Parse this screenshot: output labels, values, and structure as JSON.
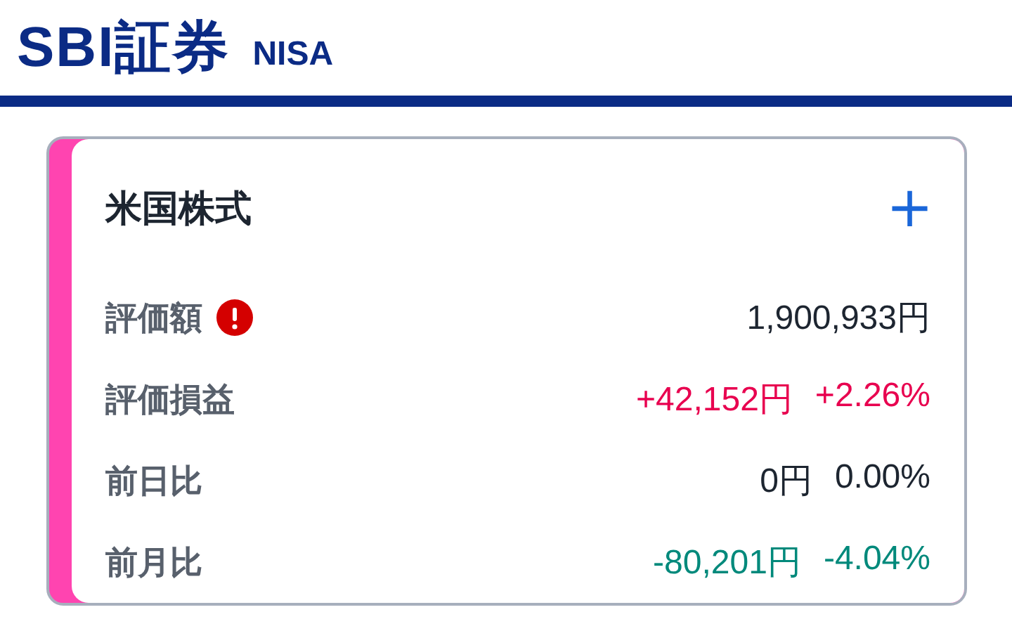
{
  "header": {
    "brand": "SBI証券",
    "tag": "NISA"
  },
  "card": {
    "title": "米国株式",
    "add_icon": "+",
    "rows": [
      {
        "label": "評価額",
        "warning": true,
        "values": [
          {
            "text": "1,900,933円",
            "color": "#1d2530"
          }
        ]
      },
      {
        "label": "評価損益",
        "warning": false,
        "values": [
          {
            "text": "+42,152円",
            "color": "#e8004f"
          },
          {
            "text": "+2.26%",
            "color": "#e8004f"
          }
        ]
      },
      {
        "label": "前日比",
        "warning": false,
        "values": [
          {
            "text": "0円",
            "color": "#1d2530"
          },
          {
            "text": "0.00%",
            "color": "#1d2530"
          }
        ]
      },
      {
        "label": "前月比",
        "warning": false,
        "values": [
          {
            "text": "-80,201円",
            "color": "#00897b"
          },
          {
            "text": "-4.04%",
            "color": "#00897b"
          }
        ]
      }
    ]
  }
}
